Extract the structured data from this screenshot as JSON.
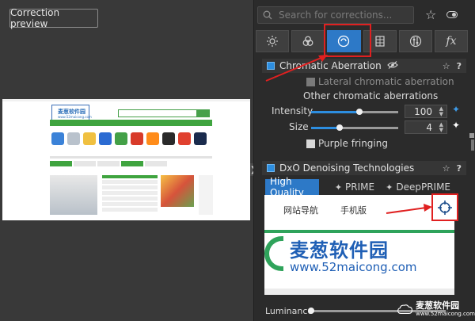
{
  "preview": {
    "correction_preview_label": "Correction preview",
    "collapse_arrow": "❯"
  },
  "panel": {
    "search_placeholder": "Search for corrections...",
    "tabs": [
      {
        "name": "light-tab",
        "icon": "sun-icon"
      },
      {
        "name": "color-tab",
        "icon": "circles-icon"
      },
      {
        "name": "detail-tab",
        "icon": "lens-icon",
        "active": true
      },
      {
        "name": "geometry-tab",
        "icon": "grid-icon"
      },
      {
        "name": "local-adjust-tab",
        "icon": "mixer-icon"
      },
      {
        "name": "effects-tab",
        "label": "fx"
      }
    ]
  },
  "chromatic": {
    "title": "Chromatic Aberration",
    "lateral_label": "Lateral chromatic aberration",
    "other_label": "Other chromatic aberrations",
    "intensity_label": "Intensity",
    "intensity_value": "100",
    "intensity_level": 0.55,
    "size_label": "Size",
    "size_value": "4",
    "size_level": 0.33,
    "purple_label": "Purple fringing"
  },
  "denoise": {
    "title": "DxO Denoising Technologies",
    "modes": [
      "High Quality",
      "PRIME",
      "DeepPRIME"
    ],
    "active_mode": "High Quality",
    "luminance_label": "Luminance",
    "luminance_level": 0.0
  },
  "zoom_preview": {
    "nav_1": "网站导航",
    "nav_2": "手机版",
    "site_title": "麦葱软件园",
    "site_url": "www.52maicong.com"
  },
  "watermark": {
    "title": "麦葱软件园",
    "url": "www.52maicong.com"
  },
  "colors": {
    "accent": "#2d79c7",
    "highlight": "#e02020",
    "panel_bg": "#2b2b2b"
  }
}
